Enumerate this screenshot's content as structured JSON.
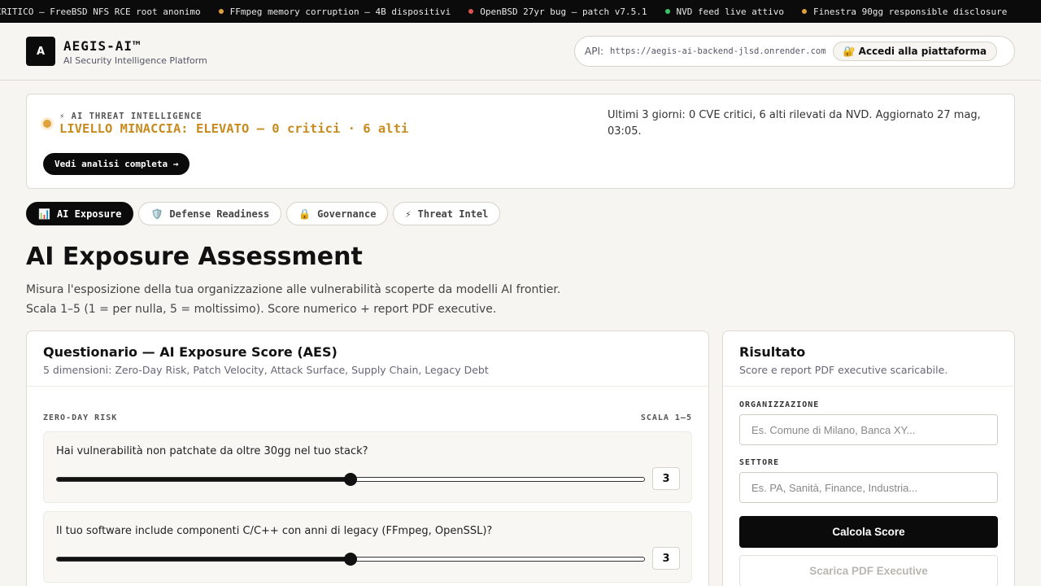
{
  "ticker": [
    {
      "text": "CRITICO — FreeBSD NFS RCE root anonimo",
      "dot": ""
    },
    {
      "text": "FFmpeg memory corruption — 4B dispositivi",
      "dot": "#e0a13a"
    },
    {
      "text": "OpenBSD 27yr bug — patch v7.5.1",
      "dot": "#e05252"
    },
    {
      "text": "NVD feed live attivo",
      "dot": "#3cc46b"
    },
    {
      "text": "Finestra 90gg responsible disclosure",
      "dot": "#e0a13a"
    }
  ],
  "header": {
    "logo": "A",
    "brand": "AEGIS-AI™",
    "subtitle": "AI Security Intelligence Platform",
    "api_label": "API:",
    "api_url": "https://aegis-ai-backend-jlsd.onrender.com",
    "login_label": "🔐 Accedi alla piattaforma"
  },
  "threat": {
    "eyebrow": "⚡ AI THREAT INTELLIGENCE",
    "level": "LIVELLO MINACCIA: ELEVATO — 0 critici · 6 alti",
    "description": "Ultimi 3 giorni: 0 CVE critici, 6 alti rilevati da NVD. Aggiornato 27 mag, 03:05.",
    "button": "Vedi analisi completa →",
    "color": "#c88b1e"
  },
  "tabs": [
    {
      "icon": "📊",
      "label": "AI Exposure",
      "active": true
    },
    {
      "icon": "🛡️",
      "label": "Defense Readiness",
      "active": false
    },
    {
      "icon": "🔒",
      "label": "Governance",
      "active": false
    },
    {
      "icon": "⚡",
      "label": "Threat Intel",
      "active": false
    }
  ],
  "page": {
    "title": "AI Exposure Assessment",
    "desc_line1": "Misura l'esposizione della tua organizzazione alle vulnerabilità scoperte da modelli AI frontier.",
    "desc_line2": "Scala 1–5 (1 = per nulla, 5 = moltissimo). Score numerico + report PDF executive."
  },
  "questionnaire": {
    "title": "Questionario — AI Exposure Score (AES)",
    "subtitle": "5 dimensioni: Zero-Day Risk, Patch Velocity, Attack Surface, Supply Chain, Legacy Debt",
    "dimension": "ZERO-DAY RISK",
    "scale": "SCALA 1–5",
    "questions": [
      {
        "text": "Hai vulnerabilità non patchate da oltre 30gg nel tuo stack?",
        "value": "3",
        "min": 1,
        "max": 5
      },
      {
        "text": "Il tuo software include componenti C/C++ con anni di legacy (FFmpeg, OpenSSL)?",
        "value": "3",
        "min": 1,
        "max": 5
      }
    ]
  },
  "result": {
    "title": "Risultato",
    "subtitle": "Score e report PDF executive scaricabile.",
    "org_label": "ORGANIZZAZIONE",
    "org_placeholder": "Es. Comune di Milano, Banca XY...",
    "sector_label": "SETTORE",
    "sector_placeholder": "Es. PA, Sanità, Finance, Industria...",
    "calc_button": "Calcola Score",
    "pdf_button": "Scarica PDF Executive"
  }
}
